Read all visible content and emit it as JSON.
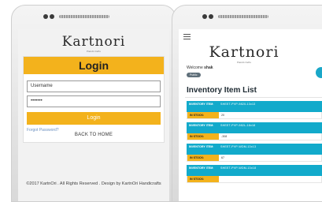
{
  "login_screen": {
    "logo": {
      "text": "Kartnori",
      "tagline": "Handicrafts"
    },
    "title": "Login",
    "username_placeholder": "Username",
    "password_value": "•••••••",
    "login_button": "Login",
    "forgot_password": "Forgot Password?",
    "back_to_home": "BACK TO HOME",
    "footer": "©2017 KartnOri . All Rights Reserved . Design by KartnOri Handicrafts"
  },
  "inventory_screen": {
    "logo": {
      "text": "Kartnori",
      "tagline": "Handicrafts"
    },
    "welcome_prefix": "Welcome",
    "welcome_user": "shak",
    "role_badge": "Public",
    "list_title": "Inventory Item List",
    "item_label": "INVENTORY ITEM:",
    "stock_label": "IN STOCK:",
    "items": [
      {
        "name": "SHEET-PVP-9820-13x13",
        "stock": "20"
      },
      {
        "name": "SHEET-PVP-982L-18x18",
        "stock": "-308"
      },
      {
        "name": "SHEET-PVP-WDM-13x13",
        "stock": "67"
      },
      {
        "name": "SHEET-PVP-WDM-13x18",
        "stock": ""
      }
    ]
  },
  "colors": {
    "accent": "#f3b21c",
    "teal": "#12aacb"
  },
  "icons": [
    "menu-icon",
    "action-fab-icon"
  ]
}
